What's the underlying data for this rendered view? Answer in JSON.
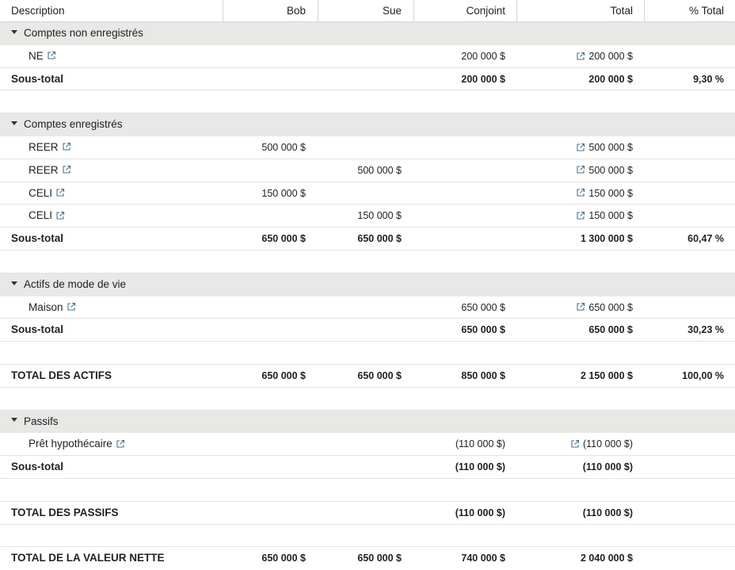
{
  "columns": {
    "description": "Description",
    "bob": "Bob",
    "sue": "Sue",
    "conjoint": "Conjoint",
    "total": "Total",
    "pct": "% Total"
  },
  "sections": {
    "non_registered": {
      "title": "Comptes non enregistrés",
      "items": [
        {
          "label": "NE",
          "bob": "",
          "sue": "",
          "conjoint": "200 000 $",
          "total": "200 000 $"
        }
      ],
      "subtotal": {
        "label": "Sous-total",
        "bob": "",
        "sue": "",
        "conjoint": "200 000 $",
        "total": "200 000 $",
        "pct": "9,30 %"
      }
    },
    "registered": {
      "title": "Comptes enregistrés",
      "items": [
        {
          "label": "REER",
          "bob": "500 000 $",
          "sue": "",
          "conjoint": "",
          "total": "500 000 $"
        },
        {
          "label": "REER",
          "bob": "",
          "sue": "500 000 $",
          "conjoint": "",
          "total": "500 000 $"
        },
        {
          "label": "CELI",
          "bob": "150 000 $",
          "sue": "",
          "conjoint": "",
          "total": "150 000 $"
        },
        {
          "label": "CELI",
          "bob": "",
          "sue": "150 000 $",
          "conjoint": "",
          "total": "150 000 $"
        }
      ],
      "subtotal": {
        "label": "Sous-total",
        "bob": "650 000 $",
        "sue": "650 000 $",
        "conjoint": "",
        "total": "1 300 000 $",
        "pct": "60,47 %"
      }
    },
    "lifestyle": {
      "title": "Actifs de mode de vie",
      "items": [
        {
          "label": "Maison",
          "bob": "",
          "sue": "",
          "conjoint": "650 000 $",
          "total": "650 000 $"
        }
      ],
      "subtotal": {
        "label": "Sous-total",
        "bob": "",
        "sue": "",
        "conjoint": "650 000 $",
        "total": "650 000 $",
        "pct": "30,23 %"
      }
    },
    "liabilities": {
      "title": "Passifs",
      "items": [
        {
          "label": "Prêt hypothécaire",
          "bob": "",
          "sue": "",
          "conjoint": "(110 000 $)",
          "total": "(110 000 $)"
        }
      ],
      "subtotal": {
        "label": "Sous-total",
        "bob": "",
        "sue": "",
        "conjoint": "(110 000 $)",
        "total": "(110 000 $)",
        "pct": ""
      }
    }
  },
  "totals": {
    "assets": {
      "label": "TOTAL DES ACTIFS",
      "bob": "650 000 $",
      "sue": "650 000 $",
      "conjoint": "850 000 $",
      "total": "2 150 000 $",
      "pct": "100,00 %"
    },
    "liabilities": {
      "label": "TOTAL DES PASSIFS",
      "bob": "",
      "sue": "",
      "conjoint": "(110 000 $)",
      "total": "(110 000 $)",
      "pct": ""
    },
    "net_worth": {
      "label": "TOTAL DE LA VALEUR NETTE",
      "bob": "650 000 $",
      "sue": "650 000 $",
      "conjoint": "740 000 $",
      "total": "2 040 000 $",
      "pct": ""
    }
  },
  "icons": {
    "caret": "caret-down-icon",
    "link": "external-link-icon"
  }
}
